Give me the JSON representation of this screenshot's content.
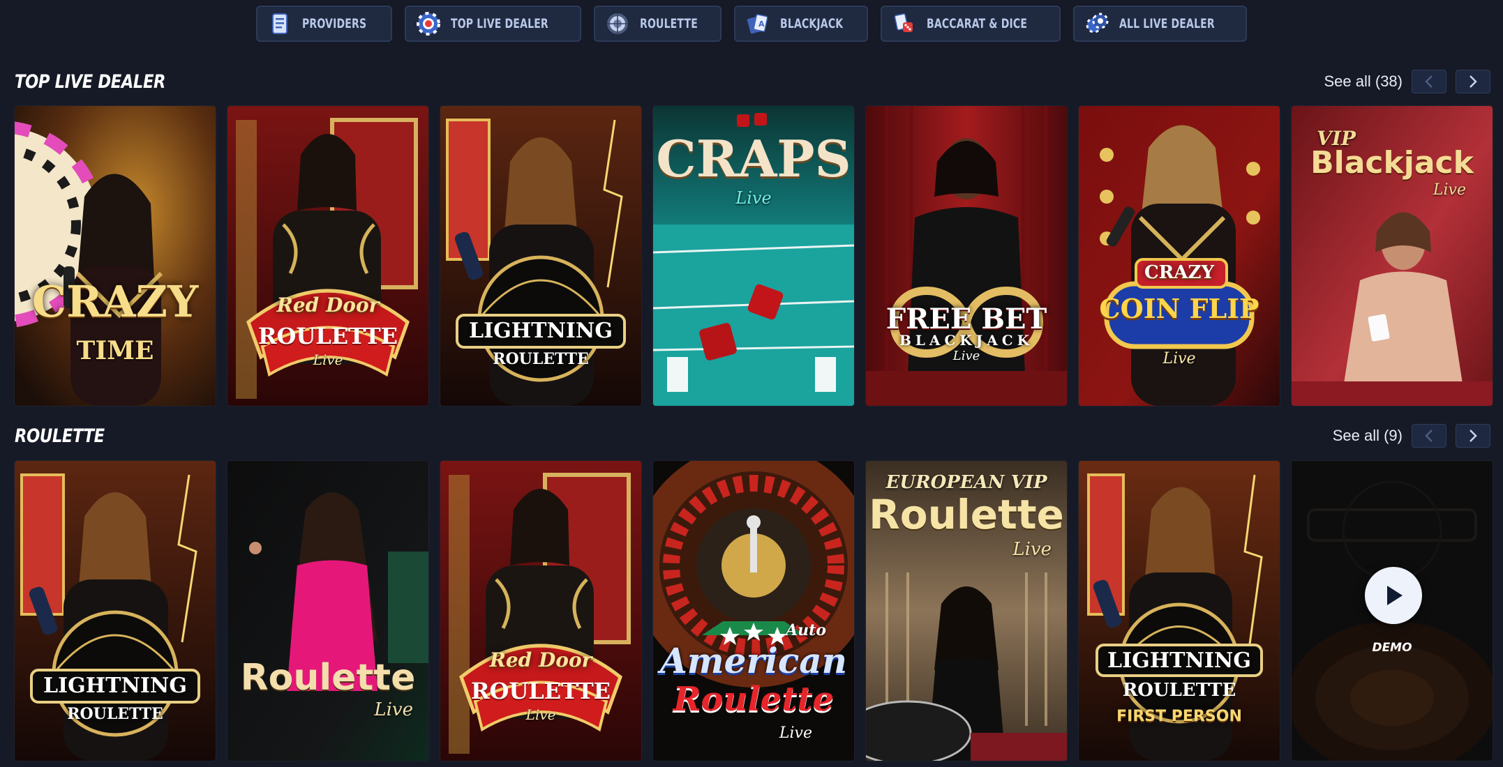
{
  "nav": [
    {
      "label": "PROVIDERS",
      "icon": "providers-icon"
    },
    {
      "label": "TOP LIVE DEALER",
      "icon": "poker-chip-icon"
    },
    {
      "label": "ROULETTE",
      "icon": "roulette-icon"
    },
    {
      "label": "BLACKJACK",
      "icon": "cards-icon"
    },
    {
      "label": "BACCARAT & DICE",
      "icon": "dice-cards-icon"
    },
    {
      "label": "ALL LIVE DEALER",
      "icon": "chips-icon"
    }
  ],
  "sections": [
    {
      "title": "TOP LIVE DEALER",
      "see_all": "See all (38)",
      "tiles": [
        {
          "name": "crazy-time",
          "title": "CRAZY",
          "subtitle": "TIME"
        },
        {
          "name": "red-door-roulette",
          "title": "Red Door",
          "subtitle": "ROULETTE",
          "badge": "Live"
        },
        {
          "name": "lightning-roulette",
          "title": "LIGHTNING",
          "subtitle": "ROULETTE"
        },
        {
          "name": "craps-live",
          "title": "CRAPS",
          "subtitle": "Live"
        },
        {
          "name": "free-bet-blackjack",
          "title": "FREE BET",
          "subtitle": "BLACKJACK",
          "badge": "Live"
        },
        {
          "name": "crazy-coin-flip",
          "title": "CRAZY",
          "subtitle": "COIN FLIP",
          "badge": "Live"
        },
        {
          "name": "vip-blackjack",
          "title": "VIP",
          "subtitle": "Blackjack",
          "badge": "Live"
        }
      ]
    },
    {
      "title": "ROULETTE",
      "see_all": "See all (9)",
      "tiles": [
        {
          "name": "lightning-roulette",
          "title": "LIGHTNING",
          "subtitle": "ROULETTE"
        },
        {
          "name": "roulette-live",
          "title": "Roulette",
          "subtitle": "Live"
        },
        {
          "name": "red-door-roulette",
          "title": "Red Door",
          "subtitle": "ROULETTE",
          "badge": "Live"
        },
        {
          "name": "american-roulette",
          "title": "American",
          "subtitle": "Roulette",
          "badge": "Live",
          "prefix": "Auto"
        },
        {
          "name": "european-vip-roulette",
          "title": "EUROPEAN VIP",
          "subtitle": "Roulette",
          "badge": "Live"
        },
        {
          "name": "lightning-roulette-first-person",
          "title": "LIGHTNING",
          "subtitle": "ROULETTE",
          "badge": "FIRST PERSON"
        },
        {
          "name": "demo-tile",
          "demo_label": "DEMO"
        }
      ]
    }
  ],
  "colors": {
    "background": "#161a26",
    "nav_bg": "#1f2940",
    "nav_text": "#b9c8e8",
    "gold": "#f7dc8a"
  }
}
